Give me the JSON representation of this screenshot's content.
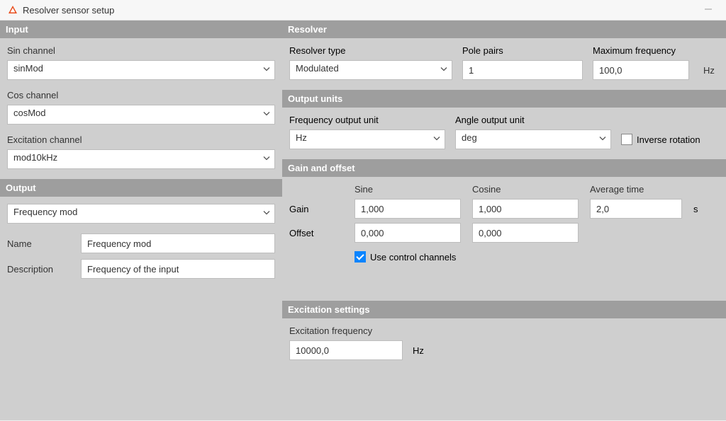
{
  "window": {
    "title": "Resolver sensor setup"
  },
  "left": {
    "input_header": "Input",
    "sin_label": "Sin channel",
    "sin_value": "sinMod",
    "cos_label": "Cos channel",
    "cos_value": "cosMod",
    "exc_label": "Excitation channel",
    "exc_value": "mod10kHz",
    "output_header": "Output",
    "out_value": "Frequency mod",
    "name_label": "Name",
    "name_value": "Frequency mod",
    "desc_label": "Description",
    "desc_value": "Frequency of the input"
  },
  "resolver": {
    "header": "Resolver",
    "type_label": "Resolver type",
    "type_value": "Modulated",
    "pole_label": "Pole pairs",
    "pole_value": "1",
    "maxfreq_label": "Maximum frequency",
    "maxfreq_value": "100,0",
    "maxfreq_unit": "Hz"
  },
  "units": {
    "header": "Output units",
    "freq_label": "Frequency output unit",
    "freq_value": "Hz",
    "angle_label": "Angle output unit",
    "angle_value": "deg",
    "inverse_label": "Inverse rotation"
  },
  "gain": {
    "header": "Gain and offset",
    "sine_label": "Sine",
    "cosine_label": "Cosine",
    "avg_label": "Average time",
    "gain_label": "Gain",
    "offset_label": "Offset",
    "gain_sine": "1,000",
    "gain_cos": "1,000",
    "offset_sine": "0,000",
    "offset_cos": "0,000",
    "avg_value": "2,0",
    "avg_unit": "s",
    "use_control": "Use control channels"
  },
  "excitation": {
    "header": "Excitation settings",
    "freq_label": "Excitation frequency",
    "freq_value": "10000,0",
    "freq_unit": "Hz"
  }
}
